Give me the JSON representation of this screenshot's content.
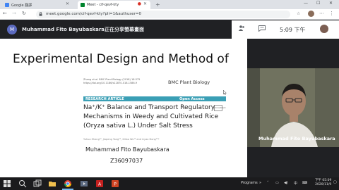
{
  "browser": {
    "tabs": [
      {
        "label": "Google 翻譯",
        "active": false,
        "favicon_color": "#4285f4"
      },
      {
        "label": "Meet - cif-qevf-kty",
        "active": true,
        "favicon_color": "#00832d"
      }
    ],
    "new_tab": "+",
    "url": "meet.google.com/cif-qevf-kty?pli=1&authuser=0",
    "window_controls": {
      "minimize": "—",
      "maximize": "☐",
      "close": "✕"
    }
  },
  "meet": {
    "avatar_initial": "M",
    "presenting_text": "Muhammad Fito Bayubaskara正在分享螢幕畫面",
    "time": "5:09 下午",
    "icons": [
      "people-icon",
      "chat-icon",
      "activities-icon"
    ]
  },
  "slide": {
    "title": "Experimental Design and Method of",
    "paper_header_1": "Zhang et al. BMC Plant Biology          (2018) 18:375",
    "paper_header_2": "https://doi.org/10.1186/s12870-018-1586-9",
    "journal": "BMC Plant Biology",
    "research_article": "RESEARCH ARTICLE",
    "open_access": "Open Access",
    "crossmark": "CrossMark",
    "paper_title_lines": [
      "Na⁺/K⁺ Balance and Transport Regulatory",
      "Mechanisms in Weedy and Cultivated Rice",
      "(Oryza sativa L.) Under Salt Stress"
    ],
    "authors": "Yuhua Zhang¹², Jiapeng Yang¹², Xiliao Wu¹² and Liyao Dong¹²*",
    "presenter_name": "Muhammad Fito Bayubaskara",
    "student_id": "Z36097037"
  },
  "video": {
    "participant_name": "Muhammad Fito Bayubaskara"
  },
  "taskbar": {
    "programs_label": "Programs",
    "chevron": "»",
    "time": "下午 05:09",
    "date": "2020/11/9"
  }
}
